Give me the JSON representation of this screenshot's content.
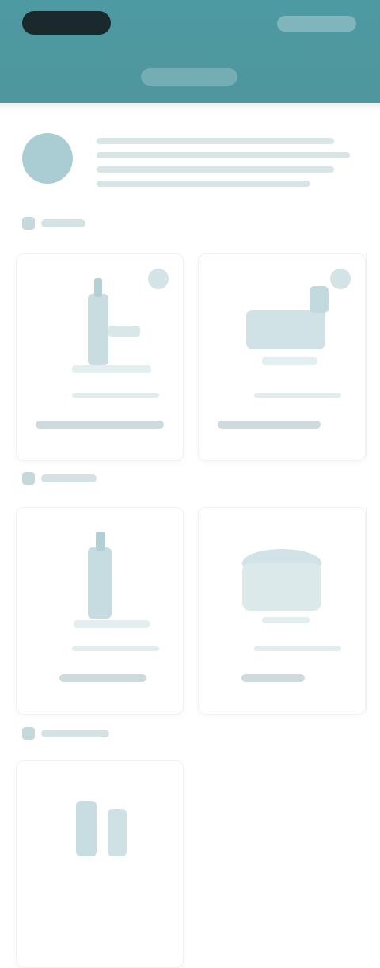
{
  "colors": {
    "header_bg": "#4f969e",
    "logo_bg": "#1a2a2c",
    "accent": "#a9cdd2"
  },
  "sections": [
    {
      "icon": "image-icon"
    },
    {
      "icon": "image-icon"
    },
    {
      "icon": "image-icon"
    }
  ]
}
